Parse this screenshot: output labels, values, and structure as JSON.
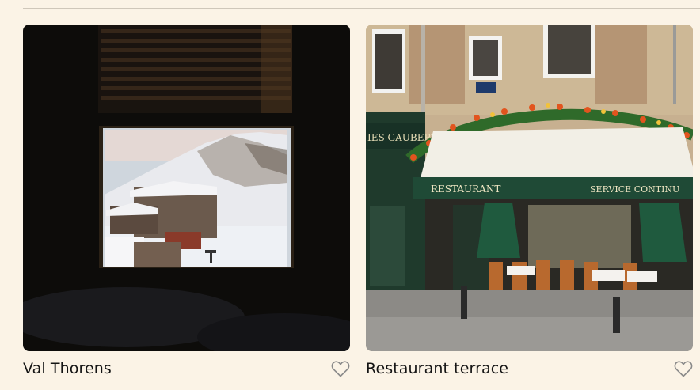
{
  "cards": [
    {
      "title": "Val Thorens",
      "icon": "heart-outline-icon",
      "favorited": false
    },
    {
      "title": "Restaurant terrace",
      "icon": "heart-outline-icon",
      "favorited": false
    }
  ],
  "photo_texts": {
    "shop_sign": "IES GAUBERT",
    "awning_left": "RESTAURANT",
    "awning_right": "SERVICE CONTINU"
  },
  "colors": {
    "background": "#fbf3e6",
    "text": "#141414",
    "heart": "#8a8a8a"
  }
}
